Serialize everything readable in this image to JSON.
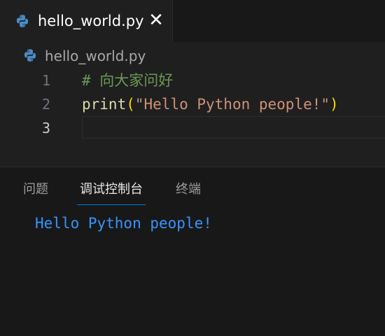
{
  "tab": {
    "filename": "hello_world.py",
    "close_glyph": "✕",
    "icon": "python-icon"
  },
  "breadcrumb": {
    "filename": "hello_world.py",
    "icon": "python-icon"
  },
  "editor": {
    "lines": [
      {
        "number": "1",
        "comment": "# 向大家问好"
      },
      {
        "number": "2",
        "func": "print",
        "open_paren": "(",
        "string": "\"Hello Python people!\"",
        "close_paren": ")"
      },
      {
        "number": "3"
      }
    ],
    "active_line": "3"
  },
  "panel": {
    "tabs": [
      {
        "label": "问题"
      },
      {
        "label": "调试控制台"
      },
      {
        "label": "终端"
      }
    ],
    "active_tab": "调试控制台",
    "output": "Hello Python people!"
  },
  "colors": {
    "background": "#1f1f1f",
    "accent": "#0078d4",
    "console_text": "#3794ff",
    "comment": "#6a9955",
    "function": "#dcdcaa",
    "string": "#ce9178",
    "bracket": "#ffd700"
  }
}
